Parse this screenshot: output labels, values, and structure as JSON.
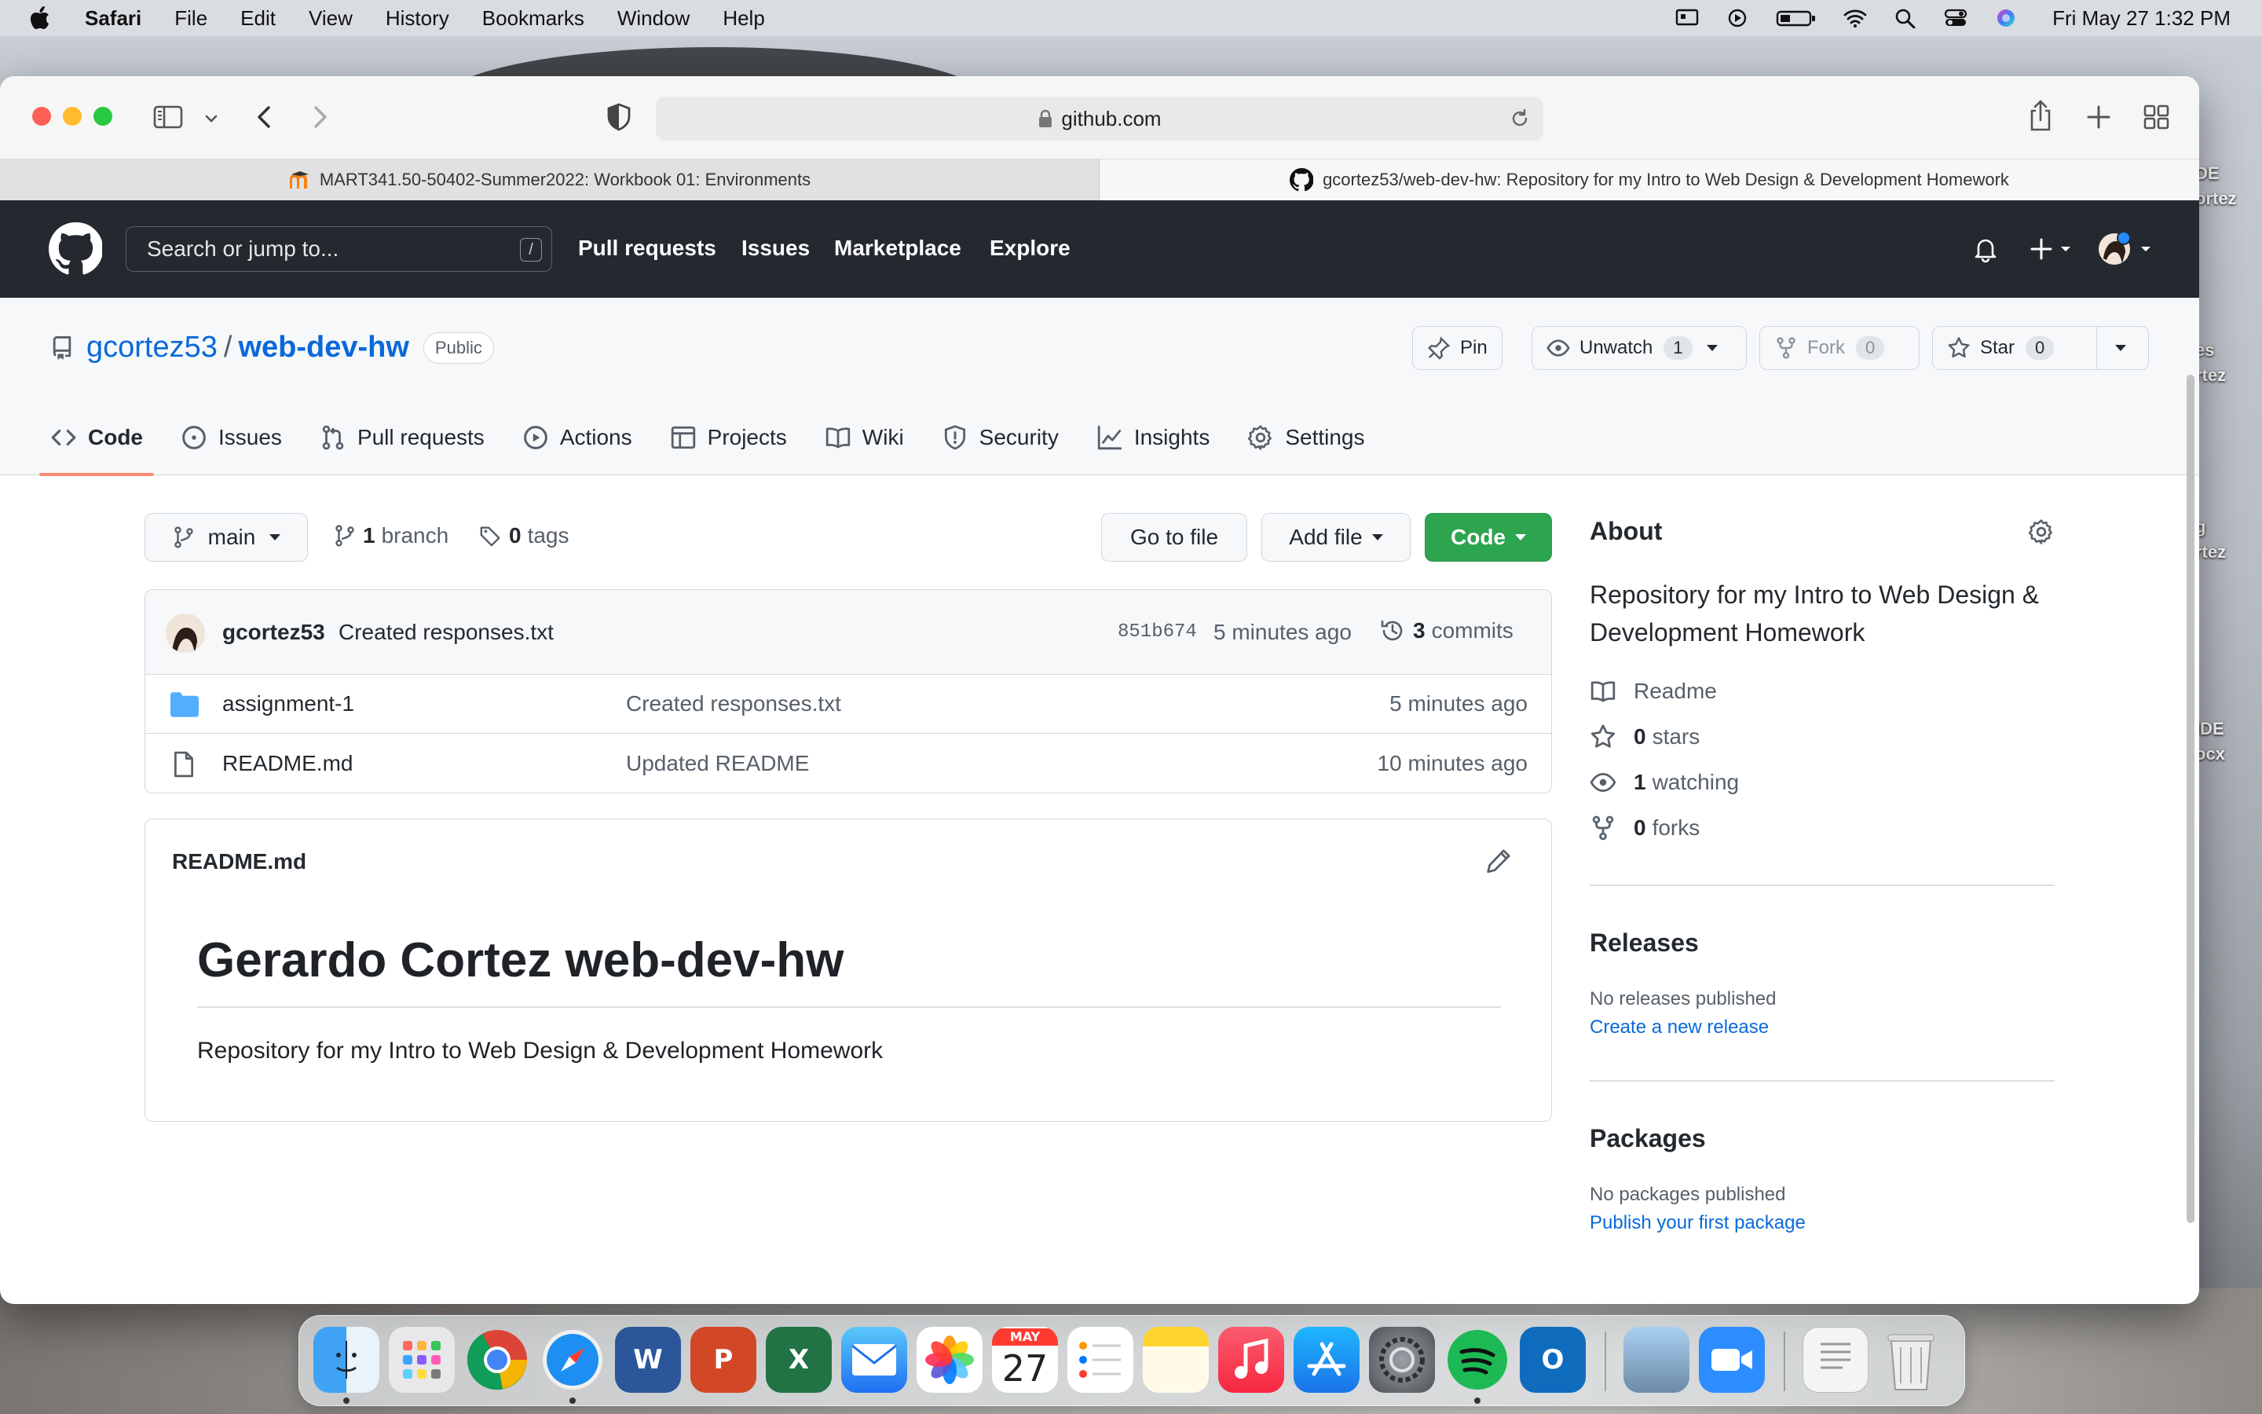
{
  "menubar": {
    "app": "Safari",
    "items": [
      "File",
      "Edit",
      "View",
      "History",
      "Bookmarks",
      "Window",
      "Help"
    ],
    "clock": "Fri May 27  1:32 PM",
    "status_icons": [
      "display-icon",
      "play-icon",
      "battery-icon",
      "wifi-icon",
      "spotlight-icon",
      "control-center-icon",
      "siri-icon"
    ]
  },
  "browser": {
    "url": "github.com",
    "tabs": [
      {
        "title": "MART341.50-50402-Summer2022: Workbook 01: Environments",
        "active": false
      },
      {
        "title": "gcortez53/web-dev-hw: Repository for my Intro to Web Design & Development Homework",
        "active": true
      }
    ]
  },
  "github_header": {
    "search_placeholder": "Search or jump to...",
    "search_shortcut": "/",
    "nav": [
      "Pull requests",
      "Issues",
      "Marketplace",
      "Explore"
    ]
  },
  "repo": {
    "owner": "gcortez53",
    "separator": "/",
    "name": "web-dev-hw",
    "visibility": "Public",
    "actions": {
      "pin": "Pin",
      "unwatch": "Unwatch",
      "unwatch_count": "1",
      "fork": "Fork",
      "fork_count": "0",
      "star": "Star",
      "star_count": "0"
    },
    "tabs": [
      "Code",
      "Issues",
      "Pull requests",
      "Actions",
      "Projects",
      "Wiki",
      "Security",
      "Insights",
      "Settings"
    ],
    "active_tab": "Code"
  },
  "code": {
    "branch_button": "main",
    "branch_count": "1",
    "branch_label": "branch",
    "tag_count": "0",
    "tag_label": "tags",
    "go_to_file": "Go to file",
    "add_file": "Add file",
    "code_button": "Code",
    "latest_commit": {
      "user": "gcortez53",
      "message": "Created responses.txt",
      "sha": "851b674",
      "time": "5 minutes ago",
      "commit_count": "3",
      "commit_label": "commits"
    },
    "files": [
      {
        "type": "folder",
        "name": "assignment-1",
        "message": "Created responses.txt",
        "time": "5 minutes ago"
      },
      {
        "type": "file",
        "name": "README.md",
        "message": "Updated README",
        "time": "10 minutes ago"
      }
    ]
  },
  "readme": {
    "filename": "README.md",
    "heading": "Gerardo Cortez web-dev-hw",
    "body": "Repository for my Intro to Web Design & Development Homework"
  },
  "sidebar": {
    "about_title": "About",
    "description": "Repository for my Intro to Web Design & Development Homework",
    "readme_label": "Readme",
    "stars_count": "0",
    "stars_label": "stars",
    "watching_count": "1",
    "watching_label": "watching",
    "forks_count": "0",
    "forks_label": "forks",
    "releases_title": "Releases",
    "releases_note": "No releases published",
    "releases_link": "Create a new release",
    "packages_title": "Packages",
    "packages_note": "No packages published",
    "packages_link": "Publish your first package"
  },
  "desktop_files": [
    {
      "line1": "DE",
      "line2": "ortez"
    },
    {
      "line1": "es",
      "line2": "rtez"
    },
    {
      "line1": "g",
      "line2": "rtez"
    },
    {
      "line1": "IDE",
      "line2": "ocx"
    }
  ],
  "dock": {
    "calendar_month": "MAY",
    "calendar_day": "27",
    "apps": [
      "finder-icon",
      "launchpad-icon",
      "chrome-icon",
      "safari-icon",
      "word-icon",
      "powerpoint-icon",
      "excel-icon",
      "mail-icon",
      "photos-icon",
      "calendar-icon",
      "reminders-icon",
      "notes-icon",
      "music-icon",
      "app-store-icon",
      "system-preferences-icon",
      "spotify-icon",
      "outlook-icon",
      "preview-icon",
      "zoom-icon",
      "document-icon",
      "trash-icon"
    ]
  },
  "colors": {
    "gh_header": "#24292f",
    "link": "#0969da",
    "code_button": "#2da44e",
    "active_tab_underline": "#fd8c73"
  }
}
